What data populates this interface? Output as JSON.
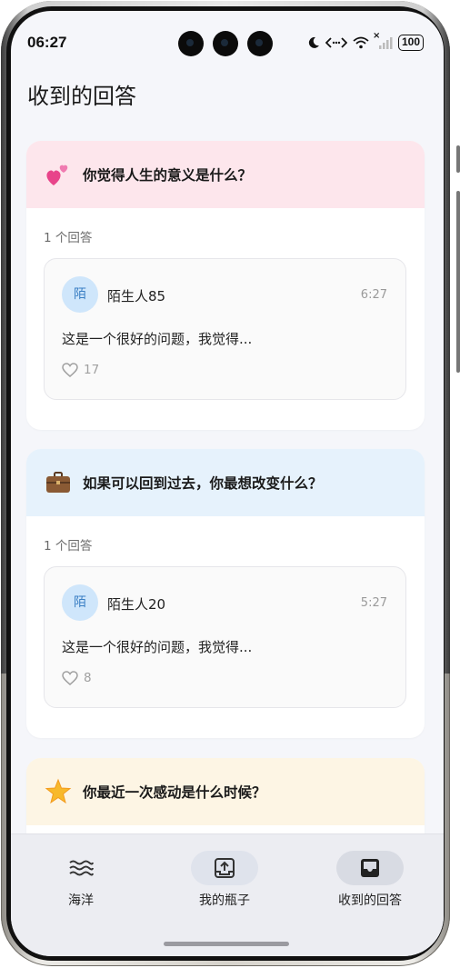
{
  "status_bar": {
    "time": "06:27",
    "battery": "100",
    "signal_mark": "×"
  },
  "page": {
    "title": "收到的回答"
  },
  "cards": [
    {
      "question": "你觉得人生的意义是什么？",
      "emoji_icon": "two-hearts-icon",
      "header_color": "#fde6ec",
      "count": "1 个回答",
      "answer": {
        "avatar": "陌",
        "user": "陌生人85",
        "time": "6:27",
        "text": "这是一个很好的问题，我觉得...",
        "likes": "17"
      }
    },
    {
      "question": "如果可以回到过去，你最想改变什么？",
      "emoji_icon": "briefcase-icon",
      "header_color": "#e6f2fc",
      "count": "1 个回答",
      "answer": {
        "avatar": "陌",
        "user": "陌生人20",
        "time": "5:27",
        "text": "这是一个很好的问题，我觉得...",
        "likes": "8"
      }
    },
    {
      "question": "你最近一次感动是什么时候？",
      "emoji_icon": "glowing-star-icon",
      "header_color": "#fdf5e4"
    }
  ],
  "tabs": [
    {
      "label": "海洋",
      "icon": "waves-icon",
      "selected": false
    },
    {
      "label": "我的瓶子",
      "icon": "upload-box-icon",
      "selected": false
    },
    {
      "label": "收到的回答",
      "icon": "inbox-icon",
      "selected": true
    }
  ],
  "colors": {
    "accent": "#3a7fc4",
    "avatar_bg": "#cfe6fb",
    "tab_pill": "#dfe3ec",
    "background": "#f5f6fa"
  }
}
